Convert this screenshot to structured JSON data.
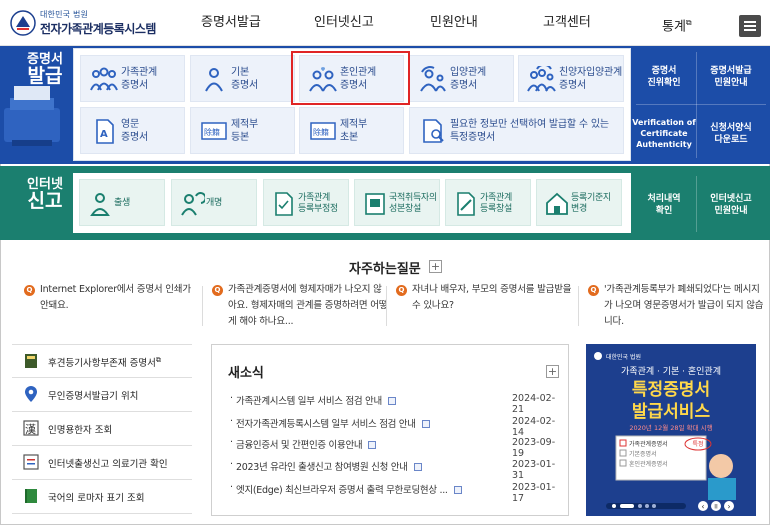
{
  "header": {
    "logo_small": "대한민국 법원",
    "logo_main": "전자가족관계등록시스템",
    "nav": [
      {
        "label": "증명서발급",
        "ext": false
      },
      {
        "label": "인터넷신고",
        "ext": false
      },
      {
        "label": "민원안내",
        "ext": false
      },
      {
        "label": "고객센터",
        "ext": false
      },
      {
        "label": "통계",
        "ext": true
      }
    ],
    "external_mark": "⧉",
    "menu_icon": "hamburger-menu-icon"
  },
  "issue_section": {
    "title_line1": "증명서",
    "title_line2": "발급",
    "cards": [
      {
        "label": "가족관계\n증명서",
        "icon": "family-icon"
      },
      {
        "label": "기본\n증명서",
        "icon": "person-icon"
      },
      {
        "label": "혼인관계\n증명서",
        "icon": "couple-icon"
      },
      {
        "label": "입양관계\n증명서",
        "icon": "adoption-icon"
      },
      {
        "label": "친양자입양관계\n증명서",
        "icon": "adoption-family-icon"
      },
      {
        "label": "영문\n증명서",
        "icon": "document-a-icon"
      },
      {
        "label": "제적부\n등본",
        "icon": "register-stamp-icon"
      },
      {
        "label": "제적부\n초본",
        "icon": "register-stamp-icon"
      },
      {
        "label": "필요한 정보만 선택하여 발급할 수 있는\n특정증명서",
        "icon": "document-search-icon"
      }
    ],
    "side": [
      {
        "label": "증명서\n진위확인"
      },
      {
        "label": "증명서발급\n민원안내"
      },
      {
        "label": "Verification of\nCertificate\nAuthenticity"
      },
      {
        "label": "신청서양식\n다운로드"
      }
    ]
  },
  "report_section": {
    "title_line1": "인터넷",
    "title_line2": "신고",
    "cards": [
      {
        "label": "출생",
        "icon": "baby-icon"
      },
      {
        "label": "개명",
        "icon": "rename-person-icon"
      },
      {
        "label": "가족관계\n등록부정정",
        "icon": "document-check-icon"
      },
      {
        "label": "국적취득자의\n성본창설",
        "icon": "nationality-document-icon"
      },
      {
        "label": "가족관계\n등록창설",
        "icon": "document-edit-icon"
      },
      {
        "label": "등록기준지\n변경",
        "icon": "house-icon"
      }
    ],
    "side": [
      {
        "label": "처리내역\n확인"
      },
      {
        "label": "인터넷신고\n민원안내"
      }
    ]
  },
  "faq": {
    "title": "자주하는질문",
    "plus": "+",
    "q_mark": "Q",
    "items": [
      "Internet Explorer에서 증명서 인쇄가 안돼요.",
      "가족관계증명서에 형제자매가 나오지 않아요. 형제자매의 관계를 증명하려면 어떻게 해야 하나요...",
      "자녀나 배우자, 부모의 증명서를 발급받을 수 있나요?",
      "'가족관계등록부가 폐쇄되었다'는 메시지가 나오며 영문증명서가 발급이 되지 않습니다."
    ]
  },
  "quick_links": [
    {
      "label": "후견등기사항부존재 증명서",
      "ext": true,
      "icon": "book-icon"
    },
    {
      "label": "무인증명서발급기 위치",
      "ext": false,
      "icon": "map-pin-icon"
    },
    {
      "label": "인명용한자 조회",
      "ext": false,
      "icon": "hanja-book-icon"
    },
    {
      "label": "인터넷출생신고 의료기관 확인",
      "ext": false,
      "icon": "hospital-list-icon"
    },
    {
      "label": "국어의 로마자 표기 조회",
      "ext": false,
      "icon": "green-book-icon"
    }
  ],
  "news": {
    "title": "새소식",
    "plus": "+",
    "items": [
      {
        "title": "가족관계시스템 일부 서비스 점검 안내",
        "date": "2024-02-21"
      },
      {
        "title": "전자가족관계등록시스템 일부 서비스 점검 안내",
        "date": "2024-02-14"
      },
      {
        "title": "금융인증서 및 간편인증 이용안내",
        "date": "2023-09-19"
      },
      {
        "title": "2023년 유라인 출생신고 참여병원 신청 안내",
        "date": "2023-01-31"
      },
      {
        "title": "엣지(Edge) 최신브라우저 증명서 출력 무한로딩현상 ...",
        "date": "2023-01-17"
      }
    ]
  },
  "banner": {
    "org": "대한민국 법원",
    "subtitle": "가족관계 · 기본 · 혼인관계",
    "title1": "특정증명서",
    "title2": "발급서비스",
    "date_text": "2020년 12월 28일 확대 시행",
    "form_items": [
      "가족관계증명서",
      "기본증명서",
      "혼인관계증명서"
    ],
    "form_tag": "특정",
    "prev": "‹",
    "next": "›",
    "pause": "II"
  },
  "colors": {
    "blue_band": "#1c4da8",
    "green_band": "#1b7f6f",
    "highlight": "#e02525",
    "faq_q": "#e26b1e"
  }
}
